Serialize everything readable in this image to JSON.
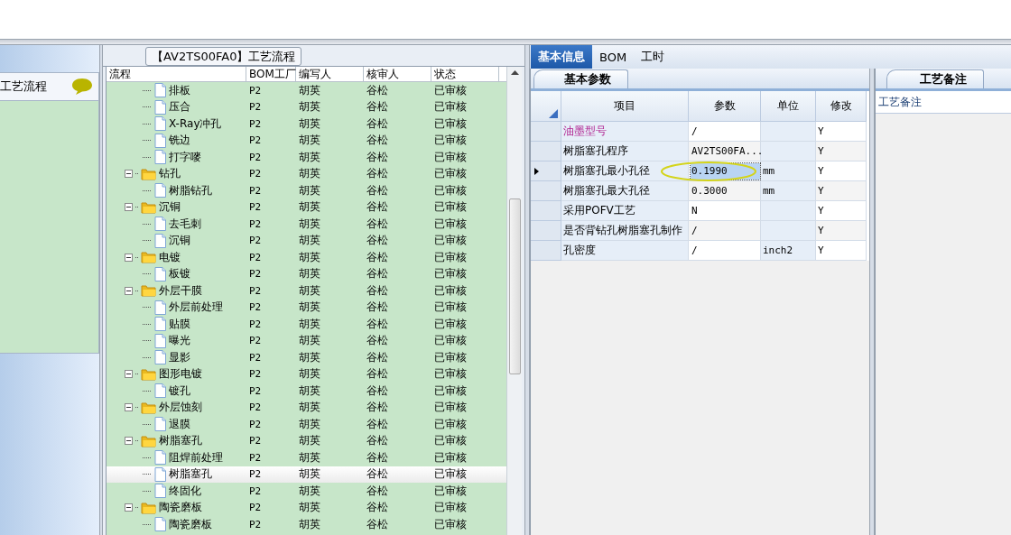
{
  "left_panel": {
    "title": "工艺流程"
  },
  "process_panel": {
    "title": "【AV2TS00FA0】工艺流程",
    "columns": [
      "流程",
      "BOM工厂",
      "编写人",
      "核审人",
      "状态"
    ],
    "tree": [
      {
        "children": [
          {
            "name": "排板",
            "bom_factory": "P2",
            "writer": "胡英",
            "reviewer": "谷松",
            "status": "已审核",
            "selected": false
          },
          {
            "name": "压合",
            "bom_factory": "P2",
            "writer": "胡英",
            "reviewer": "谷松",
            "status": "已审核",
            "selected": false
          },
          {
            "name": "X-Ray冲孔",
            "bom_factory": "P2",
            "writer": "胡英",
            "reviewer": "谷松",
            "status": "已审核",
            "selected": false
          },
          {
            "name": "铣边",
            "bom_factory": "P2",
            "writer": "胡英",
            "reviewer": "谷松",
            "status": "已审核",
            "selected": false
          },
          {
            "name": "打字嘜",
            "bom_factory": "P2",
            "writer": "胡英",
            "reviewer": "谷松",
            "status": "已审核",
            "selected": false
          }
        ]
      },
      {
        "name": "钻孔",
        "bom_factory": "P2",
        "writer": "胡英",
        "reviewer": "谷松",
        "status": "已审核",
        "expanded": true,
        "children": [
          {
            "name": "树脂钻孔",
            "bom_factory": "P2",
            "writer": "胡英",
            "reviewer": "谷松",
            "status": "已审核",
            "selected": false
          }
        ]
      },
      {
        "name": "沉铜",
        "bom_factory": "P2",
        "writer": "胡英",
        "reviewer": "谷松",
        "status": "已审核",
        "expanded": true,
        "children": [
          {
            "name": "去毛刺",
            "bom_factory": "P2",
            "writer": "胡英",
            "reviewer": "谷松",
            "status": "已审核",
            "selected": false
          },
          {
            "name": "沉铜",
            "bom_factory": "P2",
            "writer": "胡英",
            "reviewer": "谷松",
            "status": "已审核",
            "selected": false
          }
        ]
      },
      {
        "name": "电镀",
        "bom_factory": "P2",
        "writer": "胡英",
        "reviewer": "谷松",
        "status": "已审核",
        "expanded": true,
        "children": [
          {
            "name": "板镀",
            "bom_factory": "P2",
            "writer": "胡英",
            "reviewer": "谷松",
            "status": "已审核",
            "selected": false
          }
        ]
      },
      {
        "name": "外层干膜",
        "bom_factory": "P2",
        "writer": "胡英",
        "reviewer": "谷松",
        "status": "已审核",
        "expanded": true,
        "children": [
          {
            "name": "外层前处理",
            "bom_factory": "P2",
            "writer": "胡英",
            "reviewer": "谷松",
            "status": "已审核",
            "selected": false
          },
          {
            "name": "贴膜",
            "bom_factory": "P2",
            "writer": "胡英",
            "reviewer": "谷松",
            "status": "已审核",
            "selected": false
          },
          {
            "name": "曝光",
            "bom_factory": "P2",
            "writer": "胡英",
            "reviewer": "谷松",
            "status": "已审核",
            "selected": false
          },
          {
            "name": "显影",
            "bom_factory": "P2",
            "writer": "胡英",
            "reviewer": "谷松",
            "status": "已审核",
            "selected": false
          }
        ]
      },
      {
        "name": "图形电镀",
        "bom_factory": "P2",
        "writer": "胡英",
        "reviewer": "谷松",
        "status": "已审核",
        "expanded": true,
        "children": [
          {
            "name": "镀孔",
            "bom_factory": "P2",
            "writer": "胡英",
            "reviewer": "谷松",
            "status": "已审核",
            "selected": false
          }
        ]
      },
      {
        "name": "外层蚀刻",
        "bom_factory": "P2",
        "writer": "胡英",
        "reviewer": "谷松",
        "status": "已审核",
        "expanded": true,
        "children": [
          {
            "name": "退膜",
            "bom_factory": "P2",
            "writer": "胡英",
            "reviewer": "谷松",
            "status": "已审核",
            "selected": false
          }
        ]
      },
      {
        "name": "树脂塞孔",
        "bom_factory": "P2",
        "writer": "胡英",
        "reviewer": "谷松",
        "status": "已审核",
        "expanded": true,
        "children": [
          {
            "name": "阻焊前处理",
            "bom_factory": "P2",
            "writer": "胡英",
            "reviewer": "谷松",
            "status": "已审核",
            "selected": false
          },
          {
            "name": "树脂塞孔",
            "bom_factory": "P2",
            "writer": "胡英",
            "reviewer": "谷松",
            "status": "已审核",
            "selected": true
          },
          {
            "name": "终固化",
            "bom_factory": "P2",
            "writer": "胡英",
            "reviewer": "谷松",
            "status": "已审核",
            "selected": false
          }
        ]
      },
      {
        "name": "陶瓷磨板",
        "bom_factory": "P2",
        "writer": "胡英",
        "reviewer": "谷松",
        "status": "已审核",
        "expanded": true,
        "children": [
          {
            "name": "陶瓷磨板",
            "bom_factory": "P2",
            "writer": "胡英",
            "reviewer": "谷松",
            "status": "已审核",
            "selected": false
          }
        ]
      }
    ]
  },
  "detail_tabs": [
    {
      "label": "基本信息",
      "selected": true
    },
    {
      "label": "BOM",
      "selected": false
    },
    {
      "label": "工时",
      "selected": false
    }
  ],
  "params_panel": {
    "tab": "基本参数",
    "columns": [
      "项目",
      "参数",
      "单位",
      "修改"
    ],
    "rows": [
      {
        "item": "油墨型号",
        "value": "/",
        "modified": "Y",
        "kind": "highlighted",
        "selected": false
      },
      {
        "item": "树脂塞孔程序",
        "value": "AV2TS00FA...",
        "modified": "Y",
        "kind": "plain",
        "selected": false
      },
      {
        "item": "树脂塞孔最小孔径",
        "value": "0.1990",
        "unit": "mm",
        "modified": "Y",
        "kind": "plain",
        "selected": true
      },
      {
        "item": "树脂塞孔最大孔径",
        "value": "0.3000",
        "unit": "mm",
        "modified": "Y",
        "kind": "plain",
        "selected": false
      },
      {
        "item": "采用POFV工艺",
        "value": "N",
        "modified": "Y",
        "kind": "plain",
        "selected": false
      },
      {
        "item": "是否背钻孔树脂塞孔制作",
        "value": "/",
        "modified": "Y",
        "kind": "plain",
        "selected": false
      },
      {
        "item": "孔密度",
        "value": "/",
        "unit": "inch2",
        "modified": "Y",
        "kind": "plain",
        "selected": false
      }
    ]
  },
  "notes_panel": {
    "tab": "工艺备注",
    "label": "工艺备注"
  }
}
